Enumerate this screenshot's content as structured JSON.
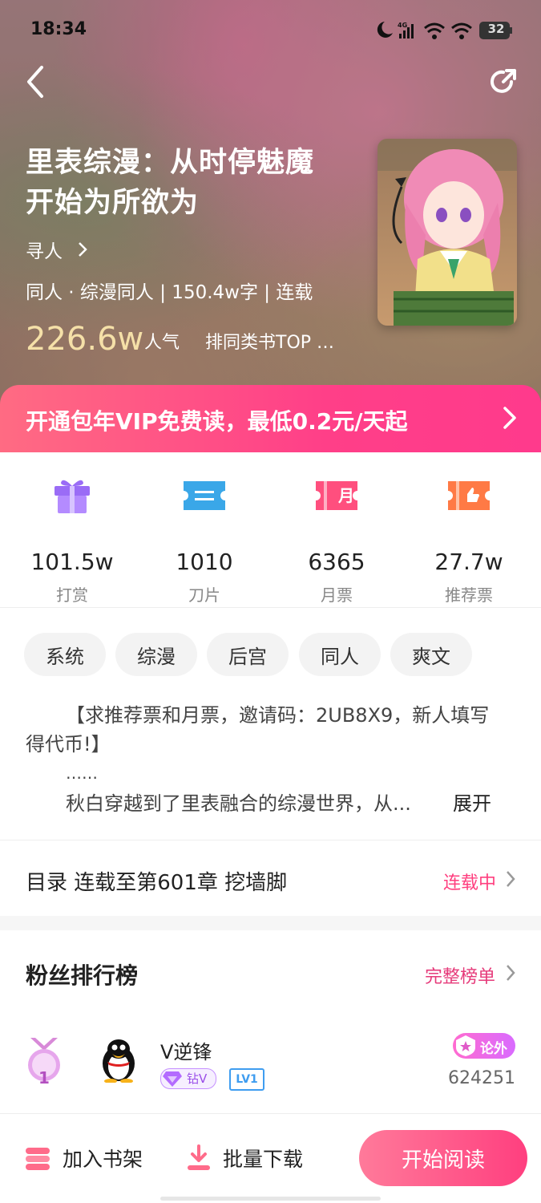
{
  "status_bar": {
    "time": "18:34",
    "battery": "32"
  },
  "book": {
    "title_line1": "里表综漫：从时停魅魔",
    "title_line2": "开始为所欲为",
    "author": "寻人",
    "meta": "同人 · 综漫同人 | 150.4w字 | 连载",
    "popularity_value": "226.6w",
    "popularity_label": "人气",
    "rank": "排同类书TOP …"
  },
  "vip_banner": {
    "text": "开通包年VIP免费读，最低0.2元/天起"
  },
  "stats": [
    {
      "value": "101.5w",
      "label": "打赏",
      "icon": "gift-icon"
    },
    {
      "value": "1010",
      "label": "刀片",
      "icon": "blade-ticket-icon"
    },
    {
      "value": "6365",
      "label": "月票",
      "icon": "monthly-ticket-icon"
    },
    {
      "value": "27.7w",
      "label": "推荐票",
      "icon": "recommend-ticket-icon"
    }
  ],
  "monthly_ticket_glyph": "月",
  "tags": [
    "系统",
    "综漫",
    "后宫",
    "同人",
    "爽文"
  ],
  "description": {
    "line1": "【求推荐票和月票，邀请码：2UB8X9，新人填写",
    "line2": "得代币!】",
    "line3": "……",
    "line4": "秋白穿越到了里表融合的综漫世界，从...",
    "expand": "展开"
  },
  "catalog": {
    "label": "目录 连载至第601章 挖墙脚",
    "status": "连载中"
  },
  "fan_ranking": {
    "title": "粉丝排行榜",
    "full_list": "完整榜单",
    "entries": [
      {
        "rank": "1",
        "name": "V逆锋",
        "badge_vip": "钻V",
        "badge_level": "LV1",
        "tag": "论外",
        "score": "624251"
      }
    ]
  },
  "bottom_bar": {
    "add_shelf": "加入书架",
    "download": "批量下载",
    "start_read": "开始阅读"
  },
  "colors": {
    "accent": "#ff3f88",
    "gold": "#f5e0a8",
    "vip_purple": "#b36bff"
  }
}
